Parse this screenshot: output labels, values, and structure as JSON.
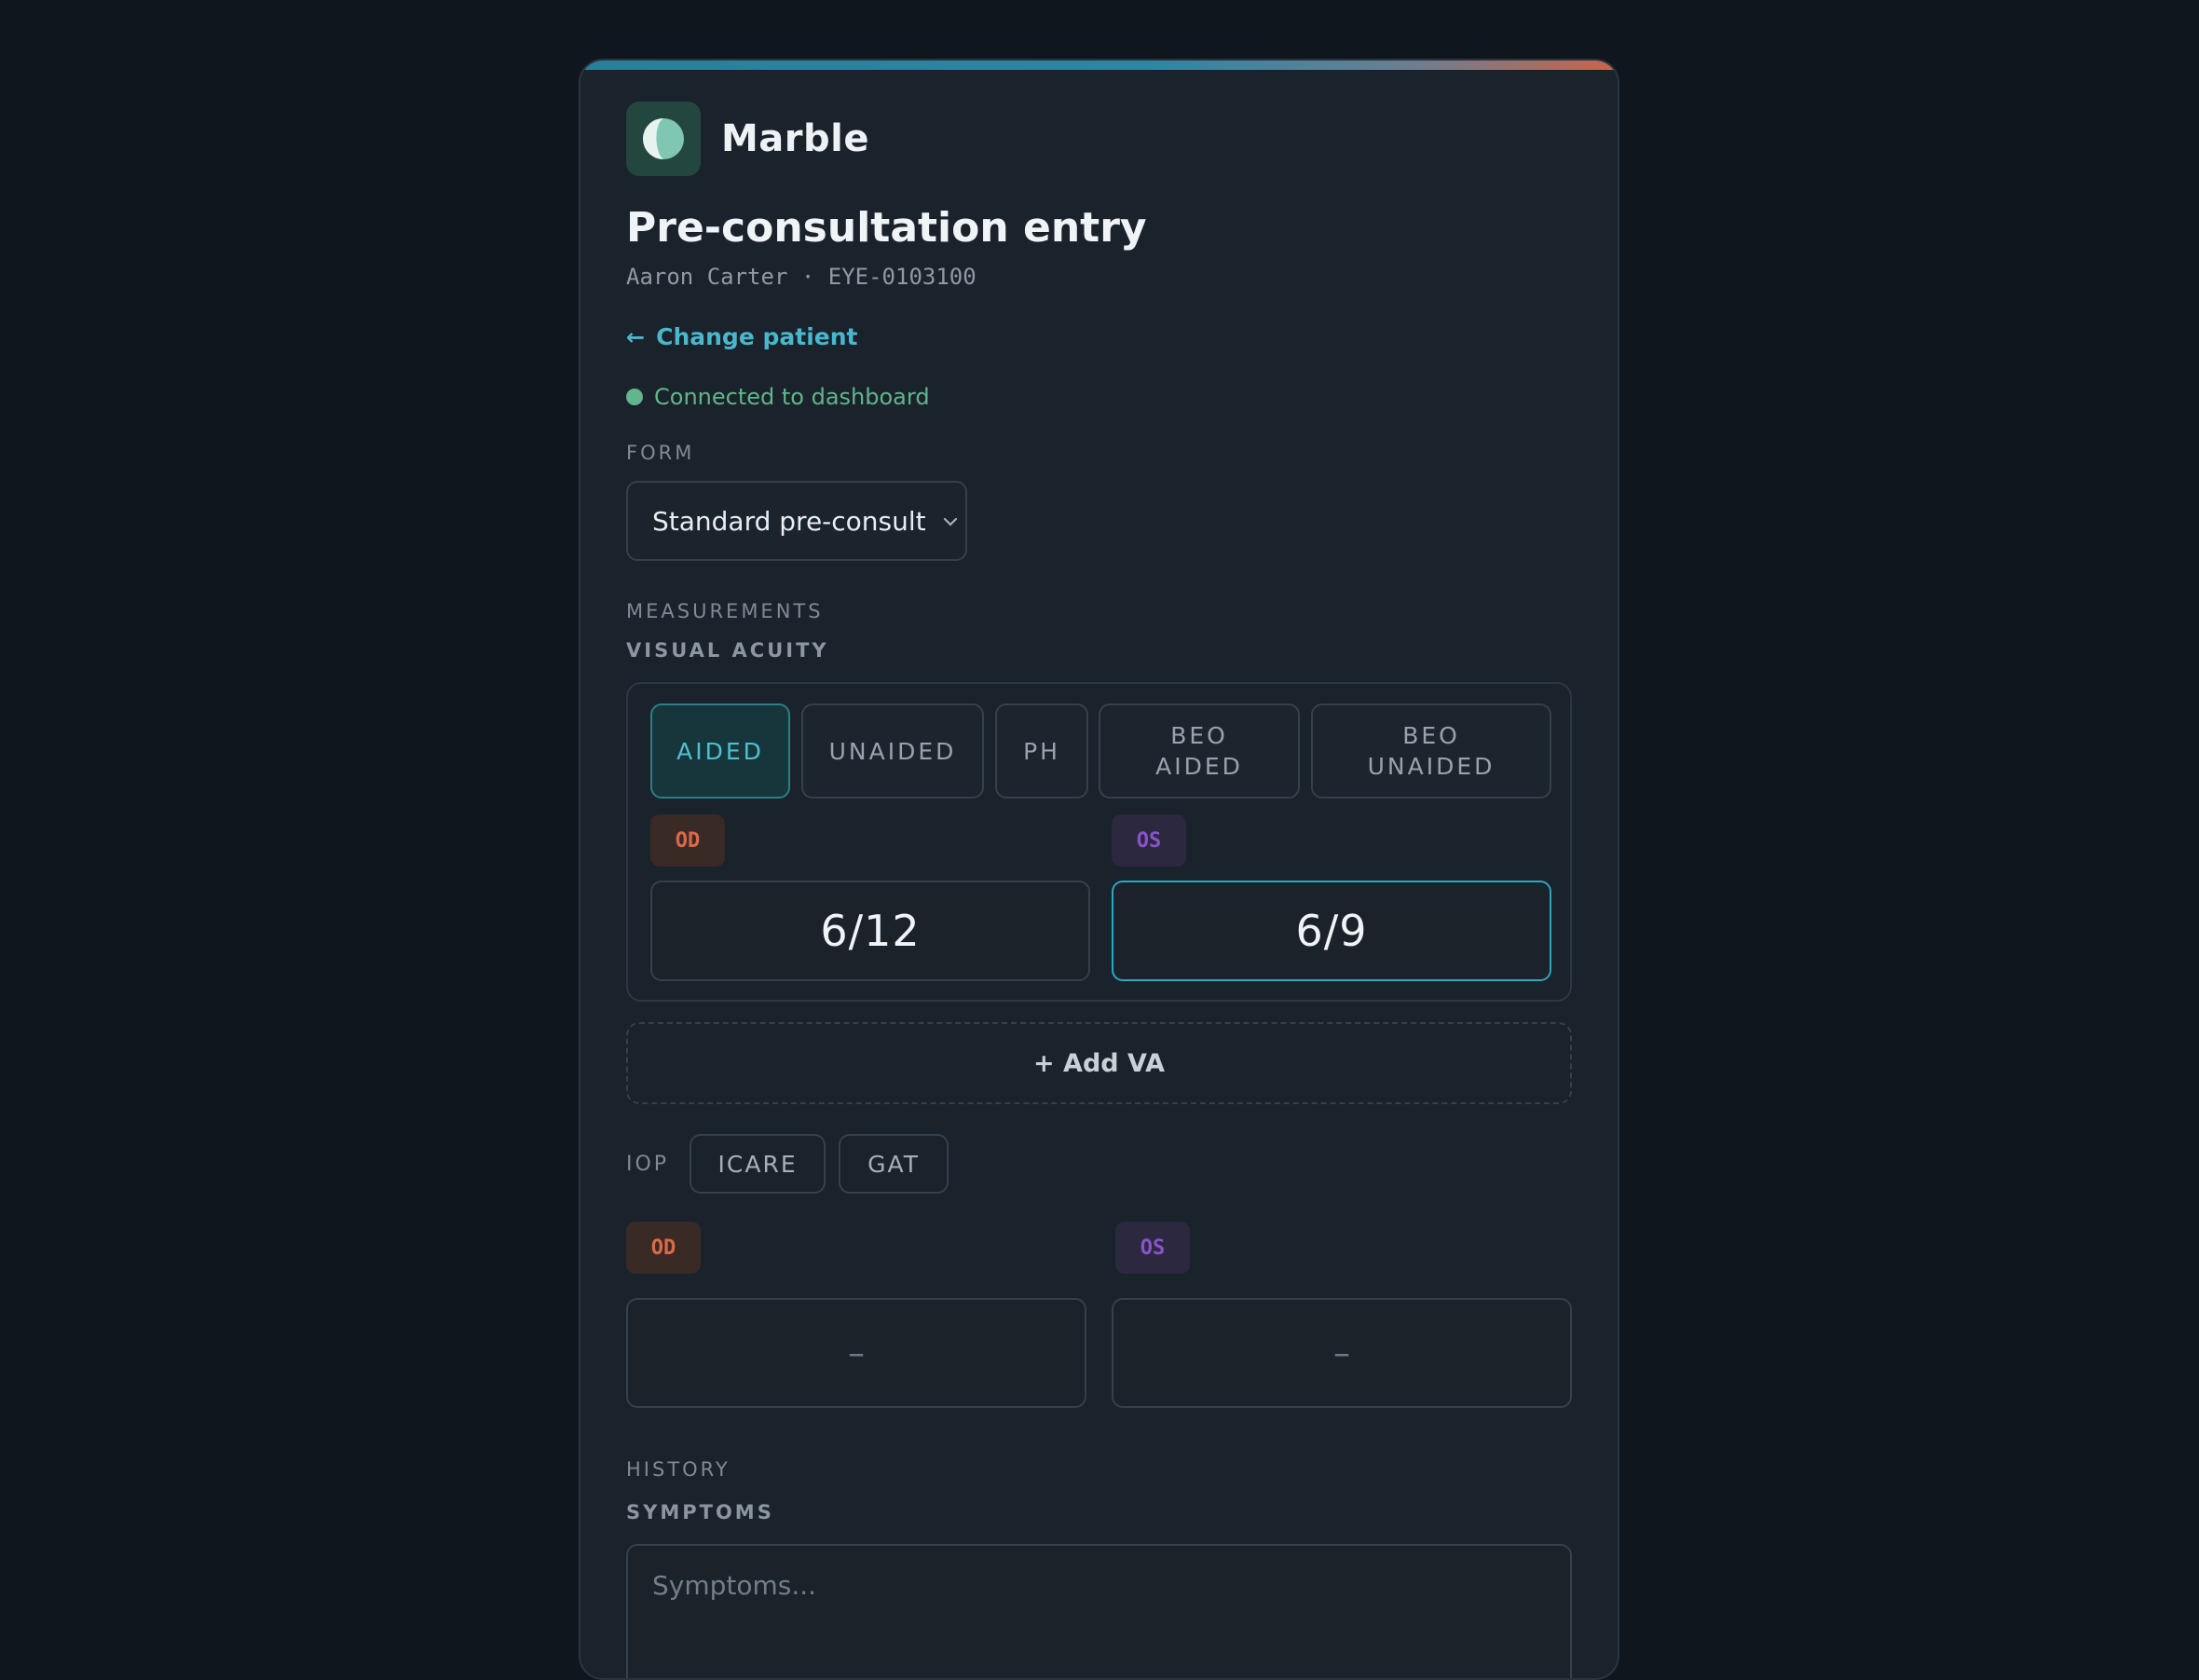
{
  "app": {
    "name": "Marble",
    "colors": {
      "accent": "#49b7cc",
      "success": "#62b58c",
      "od": "#d9694c",
      "os": "#8a53c9",
      "background": "#0f161d",
      "panel": "#1a222b"
    }
  },
  "header": {
    "logo_icon": "marble-logo-icon",
    "title": "Pre-consultation entry",
    "patient_name": "Aaron Carter",
    "separator": "·",
    "patient_id": "EYE-0103100",
    "change_patient_arrow": "←",
    "change_patient_label": "Change patient",
    "status_text": "Connected to dashboard"
  },
  "form": {
    "label": "FORM",
    "selected": "Standard pre-consult",
    "chevron_icon": "chevron-down-icon"
  },
  "measurements": {
    "label": "MEASUREMENTS",
    "visual_acuity": {
      "label": "VISUAL ACUITY",
      "modes": [
        {
          "label": "AIDED",
          "active": true
        },
        {
          "label": "UNAIDED",
          "active": false
        },
        {
          "label": "PH",
          "active": false
        },
        {
          "label": "BEO\nAIDED",
          "active": false
        },
        {
          "label": "BEO\nUNAIDED",
          "active": false
        }
      ],
      "od_label": "OD",
      "os_label": "OS",
      "od_value": "6/12",
      "os_value": "6/9"
    },
    "add_va_label": "+ Add VA",
    "iop": {
      "label": "IOP",
      "methods": [
        "ICARE",
        "GAT"
      ],
      "od_label": "OD",
      "os_label": "OS",
      "od_value": "–",
      "os_value": "–"
    }
  },
  "history": {
    "label": "HISTORY",
    "symptoms_label": "SYMPTOMS",
    "symptoms_placeholder": "Symptoms..."
  }
}
